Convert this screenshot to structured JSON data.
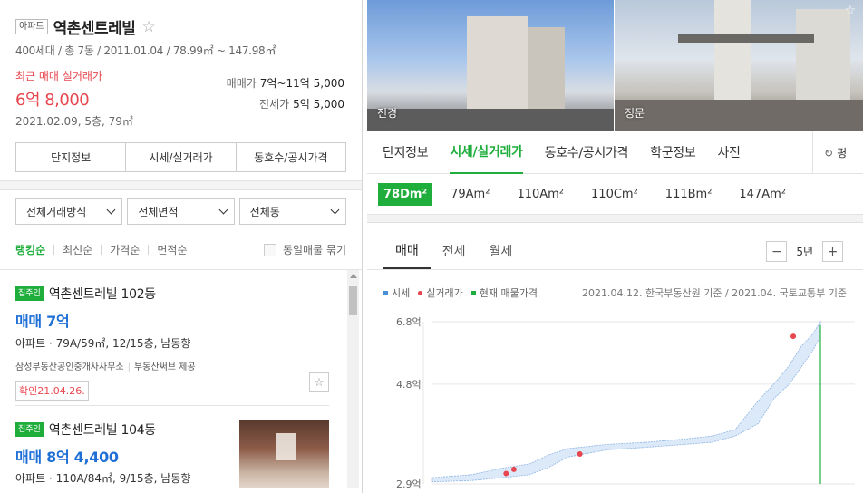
{
  "complex": {
    "type_badge": "아파트",
    "name": "역촌센트레빌",
    "favorite_icon": "star-outline-icon",
    "meta": "400세대 / 총 7동 / 2011.01.04 / 78.99㎡ ~ 147.98㎡",
    "recent_label": "최근 매매 실거래가",
    "recent_price": "6억 8,000",
    "recent_detail": "2021.02.09, 5층, 79㎡",
    "sale_label": "매매가",
    "sale_range": "7억~11억 5,000",
    "jeonse_label": "전세가",
    "jeonse_range": "5억 5,000",
    "tabs": [
      "단지정보",
      "시세/실거래가",
      "동호수/공시가격"
    ]
  },
  "filters": [
    "전체거래방식",
    "전체면적",
    "전체동"
  ],
  "sorts": [
    "랭킹순",
    "최신순",
    "가격순",
    "면적순"
  ],
  "same_listing_toggle": "동일매물 묶기",
  "listings": [
    {
      "badge": "집주인",
      "name": "역촌센트레빌 102동",
      "price": "매매 7억",
      "spec": "아파트 · 79A/59㎡, 12/15층, 남동향",
      "agent": "삼성부동산공인중개사사무소",
      "provider": "부동산써브 제공",
      "confirmed": "확인21.04.26."
    },
    {
      "badge": "집주인",
      "name": "역촌센트레빌 104동",
      "price": "매매 8억 4,400",
      "spec": "아파트 · 110A/84㎡, 9/15층, 남동향"
    }
  ],
  "photos": [
    {
      "caption": "전경"
    },
    {
      "caption": "정문"
    }
  ],
  "detail_tabs": [
    "단지정보",
    "시세/실거래가",
    "동호수/공시가격",
    "학군정보",
    "사진"
  ],
  "refresh_label": "평",
  "sizes": [
    "78Dm²",
    "79Am²",
    "110Am²",
    "110Cm²",
    "111Bm²",
    "147Am²"
  ],
  "chart_tabs": [
    "매매",
    "전세",
    "월세"
  ],
  "period": {
    "minus": "−",
    "value": "5년",
    "plus": "+"
  },
  "legend": {
    "items": [
      {
        "label": "시세",
        "color": "#4a90d9"
      },
      {
        "label": "실거래가",
        "color": "#e8464e"
      },
      {
        "label": "현재 매물가격",
        "color": "#1fae3c"
      }
    ],
    "source": "2021.04.12. 한국부동산원 기준 / 2021.04. 국토교통부 기준"
  },
  "chart_data": {
    "type": "area",
    "y_ticks": [
      "6.8억",
      "4.8억",
      "2.9억"
    ],
    "ylim": [
      2.9,
      6.8
    ],
    "x_range": [
      0,
      100
    ],
    "market_band": {
      "x": [
        0,
        10,
        18,
        25,
        30,
        35,
        45,
        55,
        65,
        72,
        78,
        84,
        88,
        92,
        95,
        98,
        100
      ],
      "low": [
        2.95,
        2.98,
        3.05,
        3.12,
        3.3,
        3.55,
        3.72,
        3.78,
        3.85,
        3.9,
        4.05,
        4.35,
        4.95,
        5.3,
        5.7,
        6.1,
        6.45
      ],
      "high": [
        3.05,
        3.12,
        3.28,
        3.38,
        3.6,
        3.75,
        3.85,
        3.9,
        3.98,
        4.05,
        4.2,
        4.9,
        5.3,
        5.75,
        6.2,
        6.5,
        6.8
      ]
    },
    "transactions": [
      {
        "x": 19,
        "y": 3.15
      },
      {
        "x": 21,
        "y": 3.25
      },
      {
        "x": 38,
        "y": 3.62
      },
      {
        "x": 93,
        "y": 6.45
      }
    ],
    "current_listing_x": 100,
    "colors": {
      "band_fill": "#dce9f8",
      "band_line": "#8fb5e3",
      "transaction": "#e8464e",
      "listing": "#1fae3c"
    }
  }
}
